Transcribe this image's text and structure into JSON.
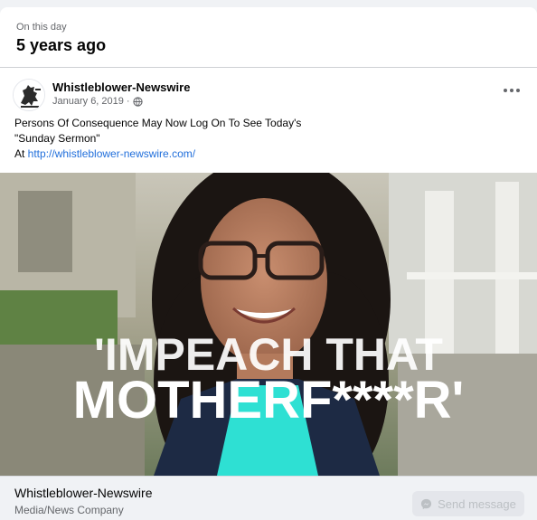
{
  "memory": {
    "kicker": "On this day",
    "title": "5 years ago"
  },
  "post": {
    "author": "Whistleblower-Newswire",
    "date": "January 6, 2019",
    "separator": "·",
    "privacy_icon": "globe-icon",
    "more_icon": "more-options-icon",
    "text_line1": "Persons Of Consequence May Now Log On To See Today's",
    "text_line2": "\"Sunday Sermon\"",
    "text_line3_prefix": "At ",
    "link": "http://whistleblower-newswire.com/"
  },
  "image": {
    "caption_line1": "'IMPEACH THAT",
    "caption_line2": "MOTHERF****R'"
  },
  "footer": {
    "page_name": "Whistleblower-Newswire",
    "category": "Media/News Company",
    "send_label": "Send message",
    "send_icon": "messenger-icon"
  },
  "colors": {
    "link": "#216fdb",
    "secondary_text": "#65676b",
    "disabled_button_bg": "#e4e6eb"
  }
}
